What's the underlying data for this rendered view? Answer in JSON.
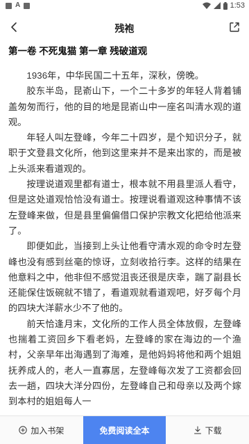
{
  "status_bar": {
    "time": "1:53",
    "left_icons": [
      "square-notification-icon",
      "a-notification-icon",
      "square-notification-icon"
    ],
    "right_icons": [
      "wifi-icon",
      "signal-icon",
      "battery-icon"
    ]
  },
  "header": {
    "title": "残袍",
    "left_icon": "back-arrow-icon",
    "right_icon": "share-icon"
  },
  "chapter_title": "第一卷 不死鬼猫 第一章 残破道观",
  "paragraphs": [
    "1936年，中华民国二十五年，深秋，傍晚。",
    "胶东半岛，昆嵛山下，一个二十多岁的年轻人背着铺盖匆匆而行，他的目的地是昆嵛山中一座名叫清水观的道观。",
    "年轻人叫左登峰，今年二十四岁，是个知识分子，就职于文登县文化所，他到这里来并不是来出家的，而是被上头派来看道观的。",
    "按理说道观里都有道士，根本就不用县里派人看守，但是这处道观恰恰没有道士。按理说看道观这种事情不该左登峰来做，但是县里偏偏借口保护宗教文化把给他派来了。",
    "即便如此，当接到上头让他看守清水观的命令时左登峰也没有感到丝毫的惊讶，立刻收拾行李。这样的结果在他意料之中，他非但不感觉沮丧还很是庆幸，踹了副县长还能保住饭碗就不错了，看道观就看道观吧，好歹每个月的四块大洋薪水少不了他的。",
    "前天恰逢月末，文化所的工作人员全体放假，左登峰也揣着工资回乡下看老妈，左登峰的家在海边的一个渔村，父亲早年出海遇到了海难，是他妈妈将他和两个姐姐抚养成人的，老人一直寡居，左登峰每次发了工资都会回去一趟，四块大洋分四份，左登峰自己和母亲以及两个嫁到本村的姐姐每人一"
  ],
  "bottom_bar": {
    "add_bookshelf": "加入书架",
    "read_free": "免费阅读全本",
    "download": "下载",
    "accent_color": "#4d84f0"
  }
}
